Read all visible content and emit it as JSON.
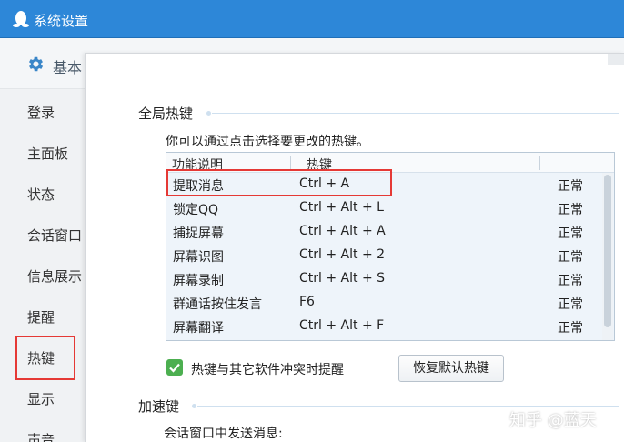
{
  "window": {
    "title": "系统设置"
  },
  "sidebar": {
    "header_label": "基本",
    "items": [
      {
        "label": "登录"
      },
      {
        "label": "主面板"
      },
      {
        "label": "状态"
      },
      {
        "label": "会话窗口"
      },
      {
        "label": "信息展示"
      },
      {
        "label": "提醒"
      },
      {
        "label": "热键"
      },
      {
        "label": "显示"
      },
      {
        "label": "声音"
      }
    ],
    "active_item": "热键"
  },
  "global_hotkeys": {
    "section_title": "全局热键",
    "hint": "你可以通过点击选择要更改的热键。",
    "columns": [
      "功能说明",
      "热键"
    ],
    "rows": [
      {
        "function": "提取消息",
        "hotkey": "Ctrl + A",
        "status": "正常"
      },
      {
        "function": "锁定QQ",
        "hotkey": "Ctrl + Alt + L",
        "status": "正常"
      },
      {
        "function": "捕捉屏幕",
        "hotkey": "Ctrl + Alt + A",
        "status": "正常"
      },
      {
        "function": "屏幕识图",
        "hotkey": "Ctrl + Alt + 2",
        "status": "正常"
      },
      {
        "function": "屏幕录制",
        "hotkey": "Ctrl + Alt + S",
        "status": "正常"
      },
      {
        "function": "群通话按住发言",
        "hotkey": "F6",
        "status": "正常"
      },
      {
        "function": "屏幕翻译",
        "hotkey": "Ctrl + Alt + F",
        "status": "正常"
      }
    ],
    "conflict_checkbox": {
      "label": "热键与其它软件冲突时提醒",
      "checked": true
    },
    "restore_button": "恢复默认热键"
  },
  "accelerators": {
    "section_title": "加速键",
    "send_message_label": "会话窗口中发送消息:"
  },
  "watermark": "知乎 @蓝天",
  "colors": {
    "titlebar": "#2d87d8",
    "highlight_box": "#e53935",
    "checkbox": "#4caf50",
    "table_bg": "#eef4fa"
  }
}
